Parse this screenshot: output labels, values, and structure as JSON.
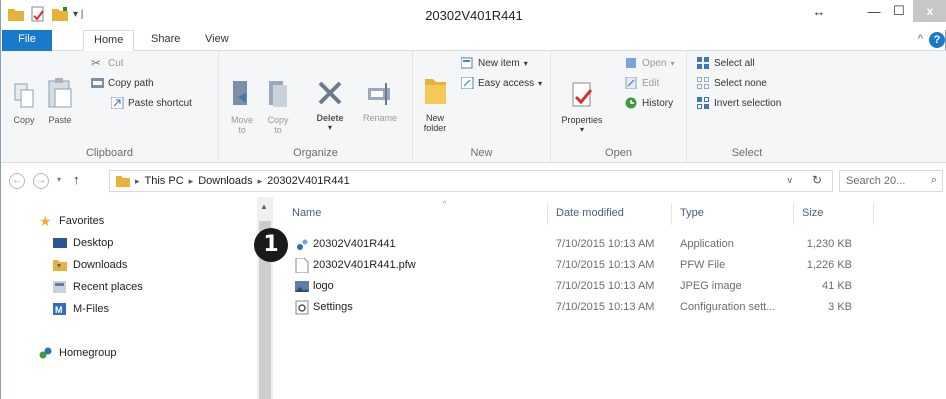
{
  "window": {
    "title": "20302V401R441",
    "arrows_glyph": "↔",
    "minimize_glyph": "—",
    "maximize_glyph": "☐",
    "close_glyph": "x"
  },
  "tabs": {
    "file": "File",
    "home": "Home",
    "share": "Share",
    "view": "View",
    "help": "?"
  },
  "ribbon": {
    "clipboard": {
      "label": "Clipboard",
      "copy": "Copy",
      "paste": "Paste",
      "cut": "Cut",
      "copy_path": "Copy path",
      "paste_shortcut": "Paste shortcut"
    },
    "organize": {
      "label": "Organize",
      "move_to": "Move to",
      "copy_to": "Copy to",
      "delete": "Delete",
      "rename": "Rename"
    },
    "new": {
      "label": "New",
      "new_folder": "New folder",
      "new_item": "New item",
      "easy_access": "Easy access"
    },
    "open": {
      "label": "Open",
      "properties": "Properties",
      "open": "Open",
      "edit": "Edit",
      "history": "History"
    },
    "select": {
      "label": "Select",
      "select_all": "Select all",
      "select_none": "Select none",
      "invert_selection": "Invert selection"
    }
  },
  "address": {
    "crumbs": [
      "This PC",
      "Downloads",
      "20302V401R441"
    ],
    "search_placeholder": "Search 20..."
  },
  "nav": {
    "favorites": "Favorites",
    "desktop": "Desktop",
    "downloads": "Downloads",
    "recent": "Recent places",
    "mfiles": "M-Files",
    "homegroup": "Homegroup"
  },
  "columns": {
    "name": "Name",
    "date": "Date modified",
    "type": "Type",
    "size": "Size"
  },
  "files": [
    {
      "name": "20302V401R441",
      "date": "7/10/2015 10:13 AM",
      "type": "Application",
      "size": "1,230 KB",
      "icon": "application-icon"
    },
    {
      "name": "20302V401R441.pfw",
      "date": "7/10/2015 10:13 AM",
      "type": "PFW File",
      "size": "1,226 KB",
      "icon": "document-icon"
    },
    {
      "name": "logo",
      "date": "7/10/2015 10:13 AM",
      "type": "JPEG image",
      "size": "41 KB",
      "icon": "image-icon"
    },
    {
      "name": "Settings",
      "date": "7/10/2015 10:13 AM",
      "type": "Configuration sett...",
      "size": "3 KB",
      "icon": "settings-file-icon"
    }
  ],
  "callout": "1",
  "colors": {
    "accent": "#1979ca",
    "folder": "#e8b23a"
  }
}
